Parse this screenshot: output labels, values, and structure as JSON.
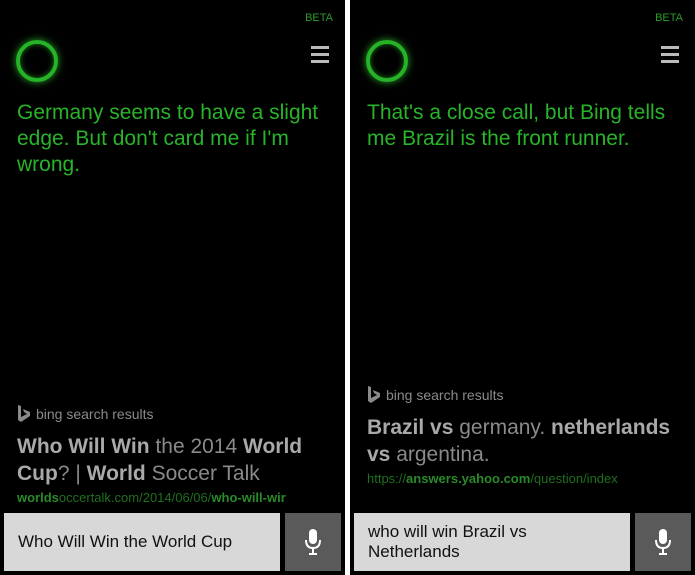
{
  "left": {
    "beta": "BETA",
    "response": "Germany seems to have a slight edge. But don't card me if I'm wrong.",
    "bing_label": "bing search results",
    "result": {
      "title_parts": [
        {
          "t": "Who Will Win",
          "b": true
        },
        {
          "t": " the 2014 ",
          "b": false
        },
        {
          "t": "World",
          "b": true
        },
        {
          "t": " Cup",
          "b": true
        },
        {
          "t": "? | ",
          "b": false
        },
        {
          "t": "World",
          "b": true
        },
        {
          "t": " Soccer Talk",
          "b": false
        }
      ],
      "url_parts": [
        {
          "t": "worlds",
          "b": true
        },
        {
          "t": "occertalk.com/2014/06/06/",
          "b": false
        },
        {
          "t": "who-will-wir",
          "b": true
        }
      ]
    },
    "query": "Who Will Win the World Cup"
  },
  "right": {
    "beta": "BETA",
    "response": "That's a close call, but Bing tells me Brazil is the front runner.",
    "bing_label": "bing search results",
    "result": {
      "title_parts": [
        {
          "t": "Brazil vs",
          "b": true
        },
        {
          "t": " germany. ",
          "b": false
        },
        {
          "t": "netherlands vs",
          "b": true
        },
        {
          "t": " argentina.",
          "b": false
        }
      ],
      "url_parts": [
        {
          "t": "https://",
          "b": false
        },
        {
          "t": "answers.yahoo.com",
          "b": true
        },
        {
          "t": "/question/index",
          "b": false
        }
      ]
    },
    "query": "who will win Brazil vs Netherlands"
  },
  "colors": {
    "background": "#000000",
    "cortana_green": "#28b428",
    "result_gray": "#8a8a8a",
    "query_box": "#d8d8d8",
    "mic_button": "#5a5a5a"
  },
  "icons": [
    "cortana-ring-icon",
    "hamburger-menu-icon",
    "bing-logo-icon",
    "microphone-icon"
  ]
}
